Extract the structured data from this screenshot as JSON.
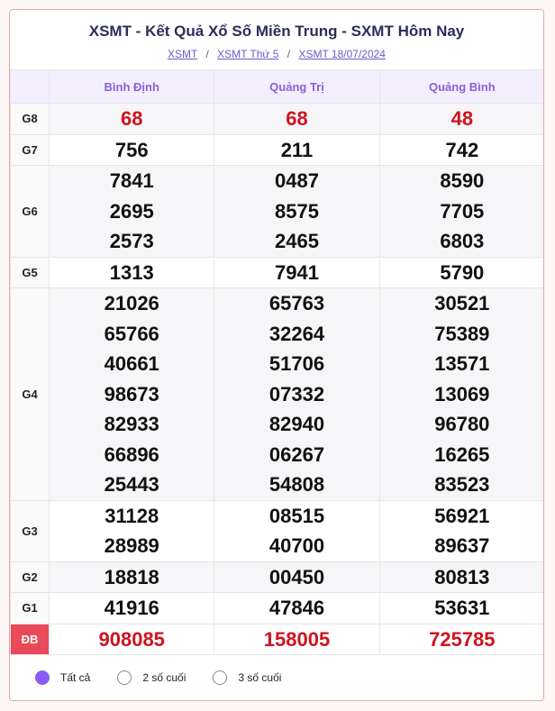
{
  "header": {
    "title": "XSMT - Kết Quả Xổ Số Miền Trung - SXMT Hôm Nay",
    "breadcrumb": [
      "XSMT",
      "XSMT Thứ 5",
      "XSMT 18/07/2024"
    ],
    "separator": "/"
  },
  "provinces": [
    "Bình Định",
    "Quảng Trị",
    "Quảng Bình"
  ],
  "prizes": [
    {
      "label": "G8",
      "values": [
        [
          "68"
        ],
        [
          "68"
        ],
        [
          "48"
        ]
      ]
    },
    {
      "label": "G7",
      "values": [
        [
          "756"
        ],
        [
          "211"
        ],
        [
          "742"
        ]
      ]
    },
    {
      "label": "G6",
      "values": [
        [
          "7841",
          "2695",
          "2573"
        ],
        [
          "0487",
          "8575",
          "2465"
        ],
        [
          "8590",
          "7705",
          "6803"
        ]
      ]
    },
    {
      "label": "G5",
      "values": [
        [
          "1313"
        ],
        [
          "7941"
        ],
        [
          "5790"
        ]
      ]
    },
    {
      "label": "G4",
      "values": [
        [
          "21026",
          "65766",
          "40661",
          "98673",
          "82933",
          "66896",
          "25443"
        ],
        [
          "65763",
          "32264",
          "51706",
          "07332",
          "82940",
          "06267",
          "54808"
        ],
        [
          "30521",
          "75389",
          "13571",
          "13069",
          "96780",
          "16265",
          "83523"
        ]
      ]
    },
    {
      "label": "G3",
      "values": [
        [
          "31128",
          "28989"
        ],
        [
          "08515",
          "40700"
        ],
        [
          "56921",
          "89637"
        ]
      ]
    },
    {
      "label": "G2",
      "values": [
        [
          "18818"
        ],
        [
          "00450"
        ],
        [
          "80813"
        ]
      ]
    },
    {
      "label": "G1",
      "values": [
        [
          "41916"
        ],
        [
          "47846"
        ],
        [
          "53631"
        ]
      ]
    },
    {
      "label": "ĐB",
      "values": [
        [
          "908085"
        ],
        [
          "158005"
        ],
        [
          "725785"
        ]
      ]
    }
  ],
  "filters": [
    {
      "label": "Tất cả",
      "selected": true
    },
    {
      "label": "2 số cuối",
      "selected": false
    },
    {
      "label": "3 số cuối",
      "selected": false
    }
  ],
  "colors": {
    "accent": "#8b5cf6",
    "prize_red": "#d0131f",
    "db_badge": "#e84a5a"
  }
}
